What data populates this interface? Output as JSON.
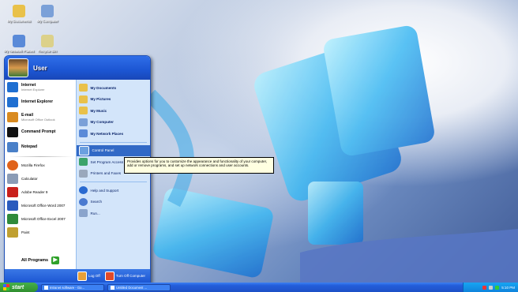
{
  "desktop": {
    "icons": [
      {
        "label": "My Documents"
      },
      {
        "label": "My Computer"
      },
      {
        "label": "My Network Places"
      },
      {
        "label": "Recycle Bin"
      }
    ]
  },
  "start_menu": {
    "username": "User",
    "pinned": [
      {
        "label": "Internet",
        "sub": "Internet Explorer",
        "icon": "internet-explorer-icon",
        "color": "#1f6fd1"
      },
      {
        "label": "Internet Explorer",
        "sub": "",
        "icon": "internet-explorer-icon",
        "color": "#1f6fd1"
      },
      {
        "label": "E-mail",
        "sub": "Microsoft Office Outlook",
        "icon": "mail-icon",
        "color": "#d98a1f"
      },
      {
        "label": "Command Prompt",
        "sub": "",
        "icon": "console-icon",
        "color": "#111111"
      },
      {
        "label": "Notepad",
        "sub": "",
        "icon": "notepad-icon",
        "color": "#4a80c8"
      }
    ],
    "recent": [
      {
        "label": "Mozilla Firefox",
        "icon": "firefox-icon",
        "color": "#e0621a"
      },
      {
        "label": "Calculator",
        "icon": "calculator-icon",
        "color": "#8a9bb5"
      },
      {
        "label": "Adobe Reader 9",
        "icon": "pdf-icon",
        "color": "#c9201b"
      },
      {
        "label": "Microsoft Office Word 2007",
        "icon": "word-icon",
        "color": "#2a5bbd"
      },
      {
        "label": "Microsoft Office Excel 2007",
        "icon": "excel-icon",
        "color": "#2f8a3a"
      },
      {
        "label": "Paint",
        "icon": "paint-icon",
        "color": "#c0a030"
      }
    ],
    "all_programs": "All Programs",
    "right": [
      {
        "label": "My Documents",
        "icon": "folder-icon",
        "color": "#e9c14a",
        "bold": true
      },
      {
        "label": "My Pictures",
        "icon": "folder-icon",
        "color": "#e9c14a",
        "bold": true
      },
      {
        "label": "My Music",
        "icon": "folder-icon",
        "color": "#e9c14a",
        "bold": true
      },
      {
        "label": "My Computer",
        "icon": "computer-icon",
        "color": "#7aa0d8",
        "bold": true
      },
      {
        "label": "My Network Places",
        "icon": "network-icon",
        "color": "#5a8ad8",
        "bold": true
      },
      {
        "label": "Control Panel",
        "icon": "control-panel-icon",
        "color": "#6aa0e0",
        "bold": false,
        "highlight": true
      },
      {
        "label": "Set Program Access and Defaults",
        "icon": "defaults-icon",
        "color": "#3aa36a",
        "bold": false
      },
      {
        "label": "Printers and Faxes",
        "icon": "printer-icon",
        "color": "#9aa8bc",
        "bold": false
      },
      {
        "label": "Help and Support",
        "icon": "help-icon",
        "color": "#2a6ad0",
        "bold": false
      },
      {
        "label": "Search",
        "icon": "search-icon",
        "color": "#4a7ad0",
        "bold": false
      },
      {
        "label": "Run...",
        "icon": "run-icon",
        "color": "#8aa4cc",
        "bold": false
      }
    ],
    "footer": {
      "logoff": "Log Off",
      "turnoff": "Turn Off Computer"
    }
  },
  "tooltip": "Provides options for you to customize the appearance and functionality of your computer, add or remove programs, and set up network connections and user accounts.",
  "taskbar": {
    "start_label": "start",
    "tasks": [
      {
        "label": "Intranet software - Go..."
      },
      {
        "label": "Untitled Document ..."
      }
    ],
    "clock": "5:10 PM"
  },
  "colors": {
    "taskbar_blue": "#245edb",
    "start_green": "#3a9d3a",
    "highlight": "#3169c6",
    "tooltip_bg": "#ffffe1"
  }
}
